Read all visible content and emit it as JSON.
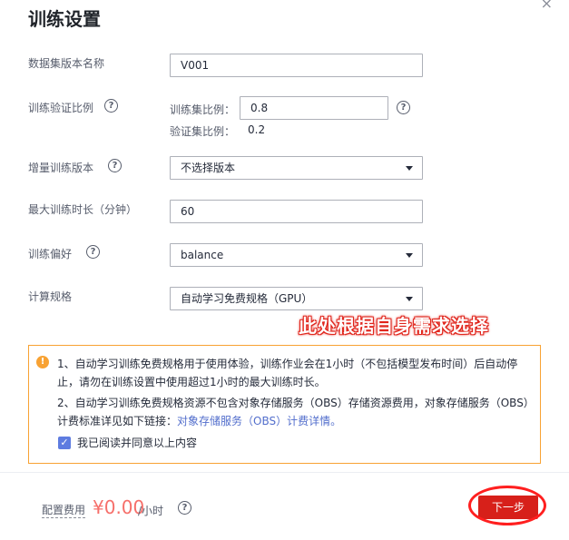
{
  "dialog": {
    "title": "训练设置",
    "close_icon": "×"
  },
  "form": {
    "dataset_version_name": {
      "label": "数据集版本名称",
      "value": "V001"
    },
    "train_val_ratio": {
      "label": "训练验证比例",
      "train_label": "训练集比例：",
      "train_value": "0.8",
      "val_label": "验证集比例：",
      "val_value": "0.2"
    },
    "incremental_version": {
      "label": "增量训练版本",
      "value": "不选择版本"
    },
    "max_duration": {
      "label": "最大训练时长（分钟）",
      "value": "60"
    },
    "preference": {
      "label": "训练偏好",
      "value": "balance"
    },
    "compute_spec": {
      "label": "计算规格",
      "value": "自动学习免费规格（GPU）"
    }
  },
  "annotation": {
    "text": "此处根据自身需求选择",
    "color": "#e0251c"
  },
  "notice": {
    "line1": "1、自动学习训练免费规格用于使用体验，训练作业会在1小时（不包括模型发布时间）后自动停止，请勿在训练设置中使用超过1小时的最大训练时长。",
    "line2_prefix": "2、自动学习训练免费规格资源不包含对象存储服务（OBS）存储资源费用，对象存储服务（OBS）计费标准详见如下链接：",
    "line2_link": "对象存储服务（OBS）计费详情。",
    "checkbox_label": "我已阅读并同意以上内容",
    "checkbox_checked": true
  },
  "footer": {
    "fee_label": "配置费用",
    "price": "¥0.00",
    "unit": "/小时",
    "next_button": "下一步"
  },
  "colors": {
    "accent": "#5e7ce0",
    "warning": "#f8a233",
    "price": "#f66f6a",
    "primary_button": "#d7201a",
    "link": "#526ecc"
  }
}
